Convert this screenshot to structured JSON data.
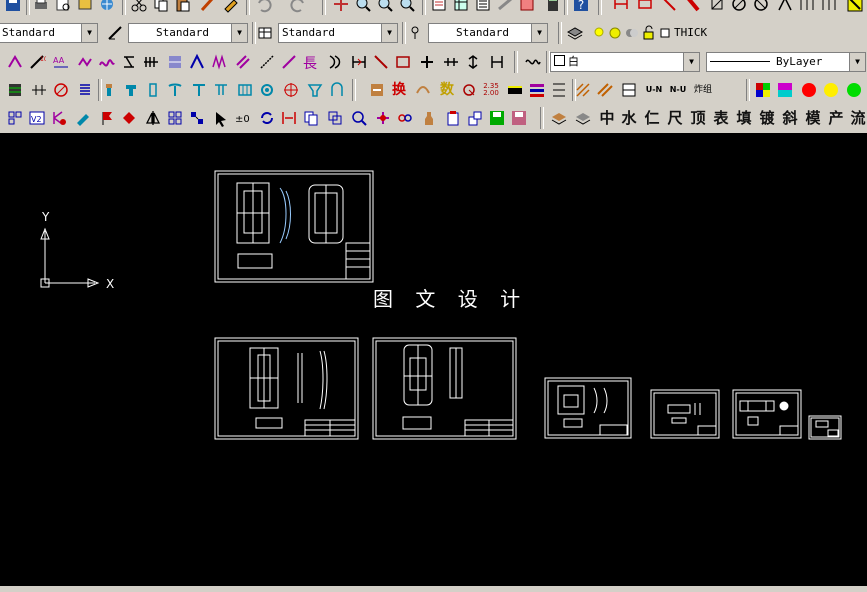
{
  "toolbar": {
    "text_style": "Standard",
    "dim_style": "Standard",
    "table_style": "Standard",
    "multileader_style": "Standard",
    "layer_name": "THICK",
    "color_value": "白",
    "linetype_value": "ByLayer",
    "row4_cn_buttons": [
      "中",
      "水",
      "仁",
      "尺",
      "顶",
      "表",
      "填",
      "镀",
      "斜",
      "模",
      "产",
      "流"
    ],
    "row3_labels": {
      "huan": "换",
      "shu": "数",
      "scale": "2.35\n2.00",
      "upn": "U-N",
      "nu": "N-U",
      "zhuanhuan": "炸组"
    }
  },
  "canvas": {
    "title": "图 文 设 计",
    "ucs_x_label": "X",
    "ucs_y_label": "Y"
  },
  "colors": {
    "toolbar_bg": "#d4d0c8",
    "canvas_bg": "#000000",
    "drawing_line": "#ffffff"
  }
}
